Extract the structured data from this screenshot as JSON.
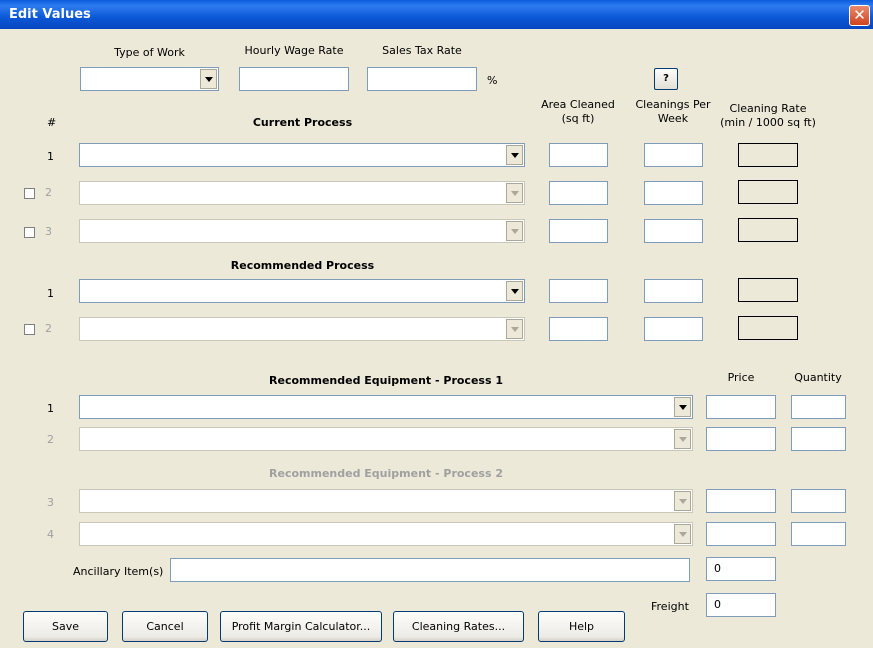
{
  "window": {
    "title": "Edit Values",
    "close_symbol": "✕"
  },
  "top_fields": {
    "type_of_work_label": "Type of Work",
    "type_of_work_value": "",
    "hourly_wage_label": "Hourly Wage Rate",
    "hourly_wage_value": "",
    "sales_tax_label": "Sales Tax Rate",
    "sales_tax_value": "",
    "percent_symbol": "%",
    "help_button_label": "?"
  },
  "headers": {
    "number": "#",
    "current_process": "Current Process",
    "area_cleaned": [
      "Area Cleaned",
      "(sq ft)"
    ],
    "cleanings_per_week": [
      "Cleanings Per",
      "Week"
    ],
    "cleaning_rate": [
      "Cleaning Rate",
      "(min / 1000 sq ft)"
    ],
    "recommended_process": "Recommended Process",
    "equipment_process_1": "Recommended Equipment - Process 1",
    "equipment_process_2": "Recommended Equipment - Process 2",
    "price": "Price",
    "quantity": "Quantity"
  },
  "current_process_rows": [
    {
      "num": "1",
      "process": "",
      "area": "",
      "cleanings": "",
      "rate": ""
    },
    {
      "num": "2",
      "process": "",
      "area": "",
      "cleanings": "",
      "rate": ""
    },
    {
      "num": "3",
      "process": "",
      "area": "",
      "cleanings": "",
      "rate": ""
    }
  ],
  "recommended_process_rows": [
    {
      "num": "1",
      "process": "",
      "area": "",
      "cleanings": "",
      "rate": ""
    },
    {
      "num": "2",
      "process": "",
      "area": "",
      "cleanings": "",
      "rate": ""
    }
  ],
  "equipment_rows": [
    {
      "num": "1",
      "equipment": "",
      "price": "",
      "quantity": ""
    },
    {
      "num": "2",
      "equipment": "",
      "price": "",
      "quantity": ""
    },
    {
      "num": "3",
      "equipment": "",
      "price": "",
      "quantity": ""
    },
    {
      "num": "4",
      "equipment": "",
      "price": "",
      "quantity": ""
    }
  ],
  "ancillary": {
    "label": "Ancillary Item(s)",
    "value": "",
    "price": "0"
  },
  "freight": {
    "label": "Freight",
    "value": "0"
  },
  "buttons": {
    "save": "Save",
    "cancel": "Cancel",
    "profit_margin": "Profit Margin Calculator...",
    "cleaning_rates": "Cleaning Rates...",
    "help": "Help"
  },
  "colors": {
    "title_bar": "#0A5BDB",
    "dialog_bg": "#ECE9D8",
    "disabled_text": "#A0A0A0",
    "close_button": "#D0431F"
  }
}
